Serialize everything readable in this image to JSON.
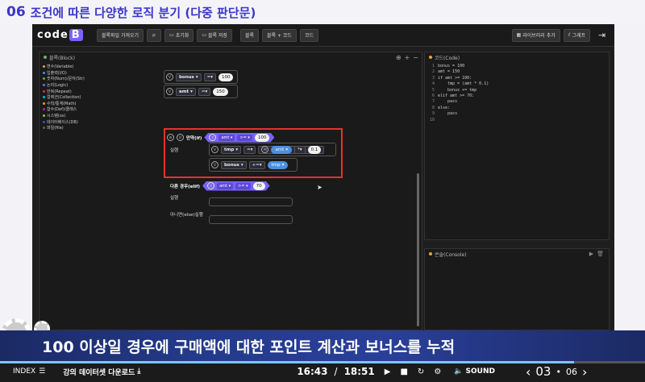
{
  "lesson": {
    "number": "06",
    "title": "조건에 따른 다양한 로직 분기 (다중 판단문)"
  },
  "toolbar": {
    "logo_prefix": "code",
    "logo_suffix": "B",
    "load_blocks": "블록파일 가져오기",
    "reset": "초기화",
    "save_block": "블록 저장",
    "mode_block": "블록",
    "mode_block_code": "블록 + 코드",
    "mode_code": "코드",
    "add_library": "라이브러리 추가",
    "graph": "그래프"
  },
  "block_panel": {
    "title": "블록(Block)",
    "palette": [
      {
        "label": "변수(Variable)",
        "color": "#e8a33d"
      },
      {
        "label": "입출력(I/O)",
        "color": "#4a90e2"
      },
      {
        "label": "숫자(Num)/문자(Str)",
        "color": "#4caf50"
      },
      {
        "label": "논리(Logic)",
        "color": "#7b61ff"
      },
      {
        "label": "반복(Repeat)",
        "color": "#e91e63"
      },
      {
        "label": "컬렉션(Collection)",
        "color": "#00bcd4"
      },
      {
        "label": "수학/통계(Math)",
        "color": "#ff9800"
      },
      {
        "label": "함수(Def)/클래스",
        "color": "#9c27b0"
      },
      {
        "label": "시스템(os)",
        "color": "#8bc34a"
      },
      {
        "label": "데이터베이스(DB)",
        "color": "#3f51b5"
      },
      {
        "label": "파일(file)",
        "color": "#795548"
      }
    ]
  },
  "blocks": {
    "assign1": {
      "var": "bonus",
      "op": "=",
      "value": "100"
    },
    "assign2": {
      "var": "amt",
      "op": "=",
      "value": "150"
    },
    "if_label": "만약(if)",
    "if_cond": {
      "var": "amt",
      "op": ">=",
      "value": "100"
    },
    "do_label": "실행",
    "tmp_assign": {
      "var": "tmp",
      "op": "=",
      "inner_var": "amt",
      "inner_op": "*",
      "value": "0.1"
    },
    "bonus_assign": {
      "var": "bonus",
      "op": "+=",
      "value_var": "tmp"
    },
    "elif_label": "다른 경우(elif)",
    "elif_cond": {
      "var": "amt",
      "op": ">=",
      "value": "70"
    },
    "elif_do_label": "실행",
    "else_label": "아니면(else)실행"
  },
  "code_panel": {
    "title": "코드(Code)",
    "lines": [
      {
        "n": "1",
        "text": "bonus = 100"
      },
      {
        "n": "2",
        "text": "amt = 150"
      },
      {
        "n": "3",
        "text": "if amt >= 100:"
      },
      {
        "n": "4",
        "text": "    tmp = (amt * 0.1)"
      },
      {
        "n": "5",
        "text": "    bonus += tmp"
      },
      {
        "n": "6",
        "text": "elif amt >= 70:"
      },
      {
        "n": "7",
        "text": "    pass"
      },
      {
        "n": "8",
        "text": "else:"
      },
      {
        "n": "9",
        "text": "    pass"
      },
      {
        "n": "10",
        "text": ""
      }
    ]
  },
  "console_panel": {
    "title": "콘솔(Console)"
  },
  "subtitle": "100 이상일 경우에 구매액에 대한 포인트 계산과 보너스를 누적",
  "player": {
    "index": "INDEX",
    "download": "강의 데이터셋 다운로드",
    "current_time": "16:43",
    "total_time": "18:51",
    "sound": "SOUND",
    "page_current": "03",
    "page_total": "06",
    "progress": 0.89
  }
}
